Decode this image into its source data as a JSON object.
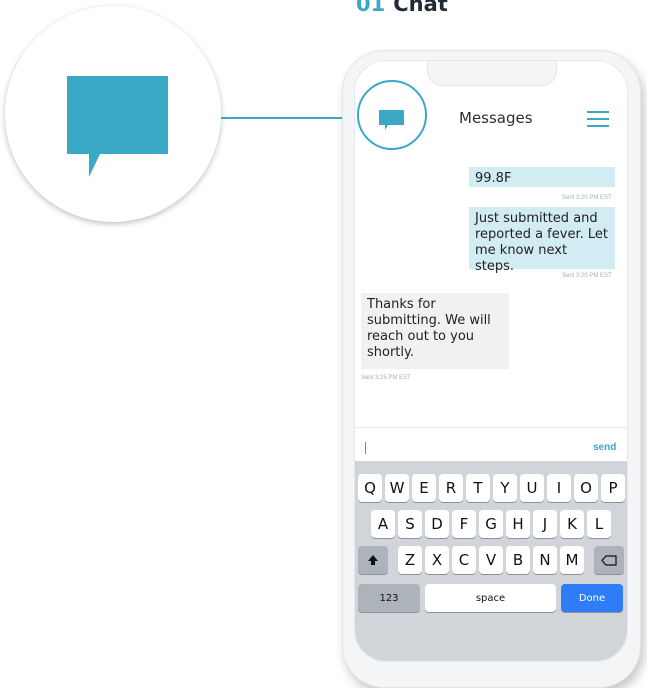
{
  "heading": {
    "number": "01",
    "title": "Chat"
  },
  "icons": {
    "hero": "chat-bubble-icon",
    "header": "chat-bubble-icon",
    "menu": "hamburger-menu-icon",
    "shift": "shift-arrow-icon",
    "backspace": "backspace-icon"
  },
  "colors": {
    "accent": "#3aa9c6",
    "outgoing_bubble": "#d2ecf4",
    "incoming_bubble": "#f0f1f3",
    "done_key": "#2e7df6"
  },
  "header": {
    "title": "Messages"
  },
  "messages": [
    {
      "direction": "outgoing",
      "text": "99.8F",
      "meta": "Sent 3:20 PM EST"
    },
    {
      "direction": "outgoing",
      "text": "Just submitted and reported a fever. Let me know next steps.",
      "meta": "Sent 3:20 PM EST"
    },
    {
      "direction": "incoming",
      "text": "Thanks for submitting. We will reach out to you shortly.",
      "meta": "Sent 3:25 PM EST"
    }
  ],
  "composer": {
    "value": "",
    "send_label": "send"
  },
  "keyboard": {
    "row1": [
      "Q",
      "W",
      "E",
      "R",
      "T",
      "Y",
      "U",
      "I",
      "O",
      "P"
    ],
    "row2": [
      "A",
      "S",
      "D",
      "F",
      "G",
      "H",
      "J",
      "K",
      "L"
    ],
    "row3": [
      "Z",
      "X",
      "C",
      "V",
      "B",
      "N",
      "M"
    ],
    "numbers_label": "123",
    "space_label": "space",
    "done_label": "Done"
  }
}
